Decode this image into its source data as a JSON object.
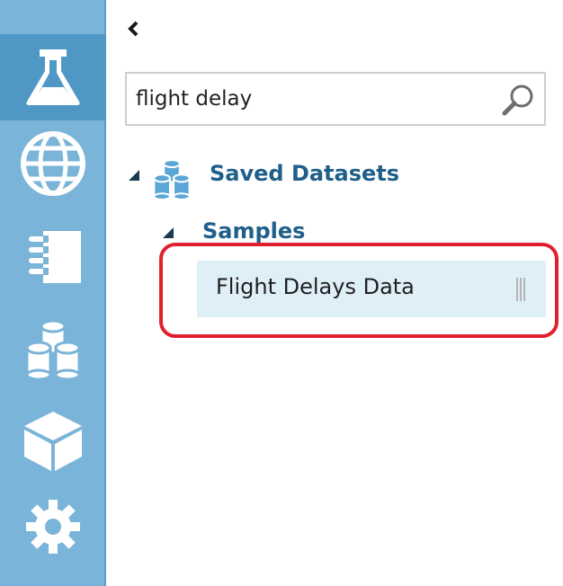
{
  "rail": {
    "items": [
      {
        "icon": "flask-icon",
        "active": true
      },
      {
        "icon": "globe-icon",
        "active": false
      },
      {
        "icon": "notebook-icon",
        "active": false
      },
      {
        "icon": "datasets-icon",
        "active": false
      },
      {
        "icon": "cube-icon",
        "active": false
      },
      {
        "icon": "gear-icon",
        "active": false
      }
    ]
  },
  "palette": {
    "collapse_icon": "chevron-left-icon",
    "search": {
      "value": "flight delay",
      "placeholder": "",
      "icon": "search-icon"
    },
    "tree": {
      "group_label": "Saved Datasets",
      "group_icon": "datasets-icon",
      "subgroup_label": "Samples",
      "items": [
        {
          "label": "Flight Delays Data",
          "selected": true
        }
      ]
    }
  },
  "colors": {
    "rail": "#7ab4d8",
    "rail_active": "#4f98c6",
    "tree_text": "#1f5f8a",
    "selected_row": "#dfeff8",
    "highlight": "#e0202e"
  }
}
